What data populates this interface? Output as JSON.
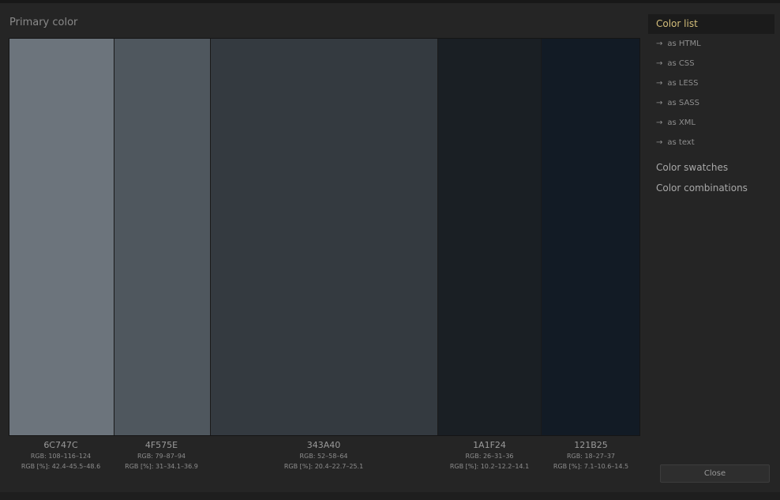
{
  "dialog": {
    "title": "Primary color",
    "close_label": "Close"
  },
  "swatches": [
    {
      "hex": "6C747C",
      "color": "#6C747C",
      "rgb": "RGB: 108–116–124",
      "pct": "RGB [%]: 42.4–45.5–48.6"
    },
    {
      "hex": "4F575E",
      "color": "#4F575E",
      "rgb": "RGB: 79–87–94",
      "pct": "RGB [%]: 31–34.1–36.9"
    },
    {
      "hex": "343A40",
      "color": "#343A40",
      "rgb": "RGB: 52–58–64",
      "pct": "RGB [%]: 20.4–22.7–25.1"
    },
    {
      "hex": "1A1F24",
      "color": "#1A1F24",
      "rgb": "RGB: 26–31–36",
      "pct": "RGB [%]: 10.2–12.2–14.1"
    },
    {
      "hex": "121B25",
      "color": "#121B25",
      "rgb": "RGB: 18–27–37",
      "pct": "RGB [%]: 7.1–10.6–14.5"
    }
  ],
  "sidebar": {
    "items": [
      {
        "label": "Color list"
      },
      {
        "label": "as HTML",
        "arrow": "→"
      },
      {
        "label": "as CSS",
        "arrow": "→"
      },
      {
        "label": "as LESS",
        "arrow": "→"
      },
      {
        "label": "as SASS",
        "arrow": "→"
      },
      {
        "label": "as XML",
        "arrow": "→"
      },
      {
        "label": "as text",
        "arrow": "→"
      },
      {
        "label": "Color swatches"
      },
      {
        "label": "Color combinations"
      }
    ]
  },
  "colors": {
    "accent": "#d4be7a"
  }
}
